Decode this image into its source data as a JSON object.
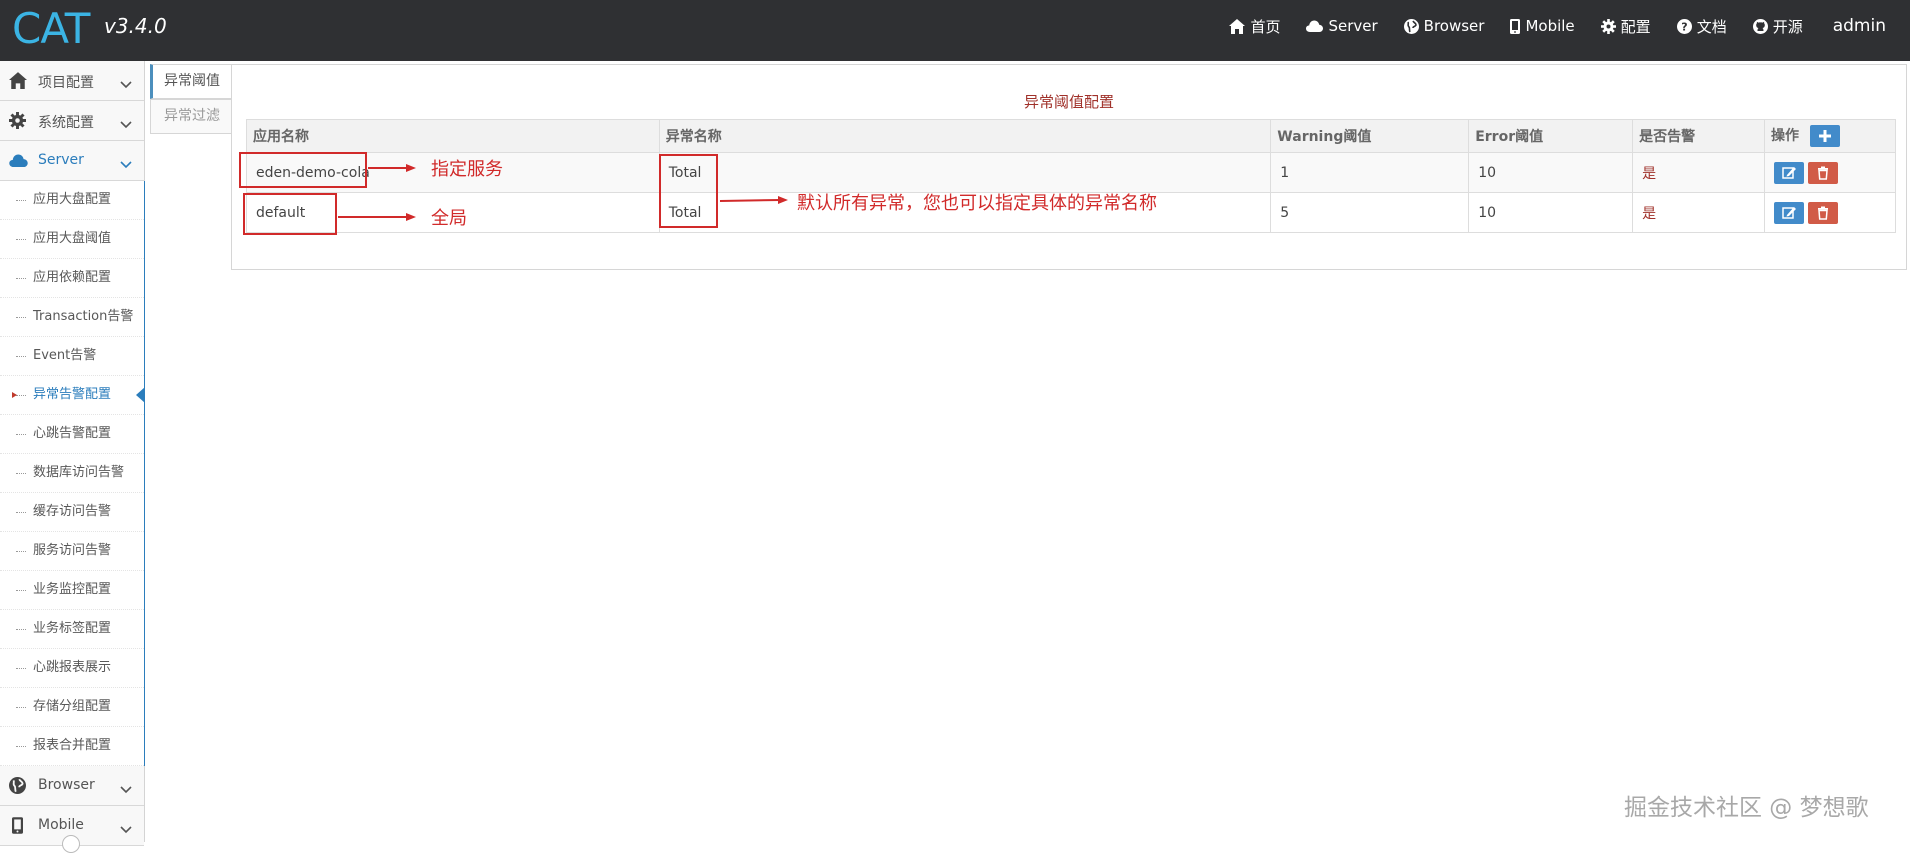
{
  "app": {
    "logo": "CAT",
    "version": "v3.4.0"
  },
  "nav": {
    "items": [
      {
        "label": "首页",
        "icon": "home-icon"
      },
      {
        "label": "Server",
        "icon": "cloud-icon"
      },
      {
        "label": "Browser",
        "icon": "globe-icon"
      },
      {
        "label": "Mobile",
        "icon": "mobile-icon"
      },
      {
        "label": "配置",
        "icon": "gear-icon"
      },
      {
        "label": "文档",
        "icon": "question-icon"
      },
      {
        "label": "开源",
        "icon": "github-icon"
      }
    ],
    "user": "admin"
  },
  "sidebar": {
    "groups": [
      {
        "label": "项目配置",
        "icon": "home-icon"
      },
      {
        "label": "系统配置",
        "icon": "gear-icon"
      },
      {
        "label": "Server",
        "icon": "cloud-icon"
      }
    ],
    "server_items": [
      "应用大盘配置",
      "应用大盘阈值",
      "应用依赖配置",
      "Transaction告警",
      "Event告警",
      "异常告警配置",
      "心跳告警配置",
      "数据库访问告警",
      "缓存访问告警",
      "服务访问告警",
      "业务监控配置",
      "业务标签配置",
      "心跳报表展示",
      "存储分组配置",
      "报表合并配置"
    ],
    "active_item": "异常告警配置",
    "bottom_groups": [
      {
        "label": "Browser",
        "icon": "globe-icon"
      },
      {
        "label": "Mobile",
        "icon": "mobile-icon"
      }
    ]
  },
  "tabs": [
    {
      "label": "异常阈值",
      "active": true
    },
    {
      "label": "异常过滤",
      "active": false
    }
  ],
  "panel": {
    "title": "异常阈值配置",
    "columns": [
      "应用名称",
      "异常名称",
      "Warning阈值",
      "Error阈值",
      "是否告警",
      "操作"
    ],
    "rows": [
      {
        "app": "eden-demo-cola",
        "exception": "Total",
        "warning": "1",
        "error": "10",
        "alarm": "是"
      },
      {
        "app": "default",
        "exception": "Total",
        "warning": "5",
        "error": "10",
        "alarm": "是"
      }
    ]
  },
  "annotations": {
    "specify_service": "指定服务",
    "global": "全局",
    "default_all": "默认所有异常，您也可以指定具体的异常名称"
  },
  "watermark": "掘金技术社区 @ 梦想歌",
  "colors": {
    "navbar_bg": "#2f3033",
    "logo": "#3bb4e4",
    "accent_blue": "#2b7dbc",
    "alarm_text": "#a0312a",
    "annotation_red": "#d12a2a",
    "delete_button": "#d15b47"
  }
}
